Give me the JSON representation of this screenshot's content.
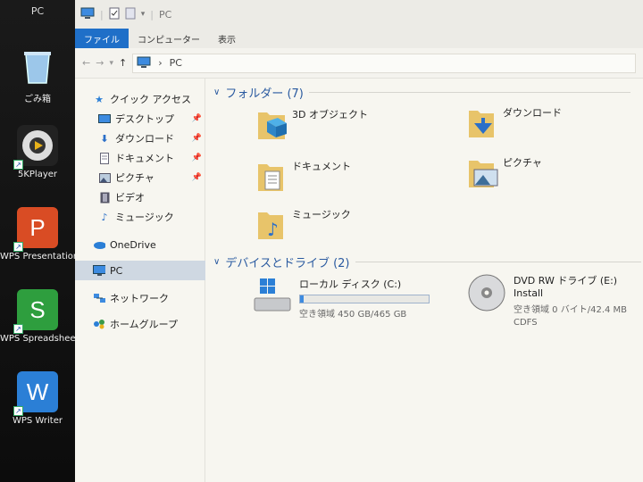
{
  "desktop": {
    "top_label": "PC",
    "icons": [
      {
        "label": "ごみ箱",
        "icon": "recycle-bin-icon"
      },
      {
        "label": "5KPlayer",
        "icon": "media-player-icon"
      },
      {
        "label": "WPS Presentation",
        "icon": "presentation-icon",
        "glyph": "P",
        "color": "#d94c24"
      },
      {
        "label": "WPS Spreadsheets",
        "icon": "spreadsheet-icon",
        "glyph": "S",
        "color": "#2e9e3e"
      },
      {
        "label": "WPS Writer",
        "icon": "writer-icon",
        "glyph": "W",
        "color": "#2b7fd6"
      }
    ]
  },
  "window": {
    "title": "PC",
    "ribbon_tabs": [
      "ファイル",
      "コンピューター",
      "表示"
    ],
    "address": {
      "location": "PC"
    }
  },
  "nav": {
    "quick_access": "クイック アクセス",
    "quick_items": [
      {
        "label": "デスクトップ",
        "pinned": true
      },
      {
        "label": "ダウンロード",
        "pinned": true
      },
      {
        "label": "ドキュメント",
        "pinned": true
      },
      {
        "label": "ピクチャ",
        "pinned": true
      },
      {
        "label": "ビデオ",
        "pinned": false
      },
      {
        "label": "ミュージック",
        "pinned": false
      }
    ],
    "onedrive": "OneDrive",
    "pc": "PC",
    "network": "ネットワーク",
    "homegroup": "ホームグループ"
  },
  "content": {
    "folders_header": "フォルダー (7)",
    "folders": [
      "3D オブジェクト",
      "ダウンロード",
      "ドキュメント",
      "ピクチャ",
      "ミュージック"
    ],
    "drives_header": "デバイスとドライブ (2)",
    "drives": [
      {
        "name": "ローカル ディスク (C:)",
        "free": "空き領域 450 GB/465 GB",
        "used_fraction": 0.03
      },
      {
        "name": "DVD RW ドライブ (E:) Install",
        "free": "空き領域 0 バイト/42.4 MB",
        "fs": "CDFS"
      }
    ]
  },
  "colors": {
    "accent": "#1f6fc8",
    "header_text": "#2a5aa0",
    "selection": "#cfd8e2"
  }
}
